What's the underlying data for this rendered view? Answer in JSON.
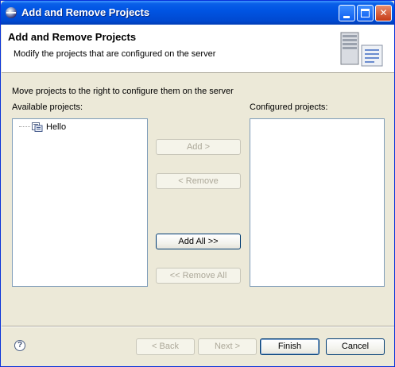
{
  "window": {
    "title": "Add and Remove Projects"
  },
  "header": {
    "title": "Add and Remove Projects",
    "subtitle": "Modify the projects that are configured on the server"
  },
  "main": {
    "instruction": "Move projects to the right to configure them on the server",
    "available_label": "Available projects:",
    "configured_label": "Configured projects:",
    "available_items": [
      "Hello"
    ],
    "configured_items": []
  },
  "buttons": {
    "add": "Add >",
    "remove": "< Remove",
    "add_all": "Add All >>",
    "remove_all": "<< Remove All"
  },
  "footer": {
    "back": "< Back",
    "next": "Next >",
    "finish": "Finish",
    "cancel": "Cancel",
    "help_glyph": "?"
  },
  "colors": {
    "titlebar": "#0054e3",
    "dialog_bg": "#ece9d8",
    "list_border": "#7f9db9",
    "disabled_text": "#aca899"
  }
}
